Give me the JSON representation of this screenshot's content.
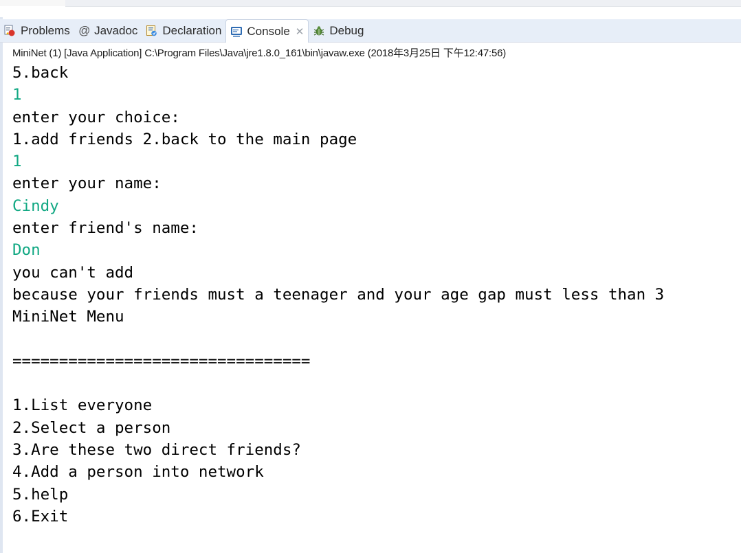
{
  "tabs": [
    {
      "label": "Problems",
      "icon": "problems-icon",
      "active": false
    },
    {
      "label": "Javadoc",
      "icon": "at-icon",
      "active": false
    },
    {
      "label": "Declaration",
      "icon": "declaration-icon",
      "active": false
    },
    {
      "label": "Console",
      "icon": "console-icon",
      "active": true,
      "close": "✕"
    },
    {
      "label": "Debug",
      "icon": "debug-icon",
      "active": false
    }
  ],
  "console_header": "MiniNet (1) [Java Application] C:\\Program Files\\Java\\jre1.8.0_161\\bin\\javaw.exe (2018年3月25日 下午12:47:56)",
  "colors": {
    "input_text": "#11a883",
    "output_text": "#000000"
  },
  "console_lines": [
    {
      "text": "5.back",
      "type": "output"
    },
    {
      "text": "1",
      "type": "input"
    },
    {
      "text": "enter your choice:",
      "type": "output"
    },
    {
      "text": "1.add friends 2.back to the main page",
      "type": "output"
    },
    {
      "text": "1",
      "type": "input"
    },
    {
      "text": "enter your name:",
      "type": "output"
    },
    {
      "text": "Cindy",
      "type": "input"
    },
    {
      "text": "enter friend's name:",
      "type": "output"
    },
    {
      "text": "Don",
      "type": "input"
    },
    {
      "text": "you can't add",
      "type": "output"
    },
    {
      "text": "because your friends must a teenager and your age gap must less than 3",
      "type": "output"
    },
    {
      "text": "MiniNet Menu",
      "type": "output"
    },
    {
      "text": "",
      "type": "output"
    },
    {
      "text": "================================",
      "type": "output"
    },
    {
      "text": "",
      "type": "output"
    },
    {
      "text": "1.List everyone",
      "type": "output"
    },
    {
      "text": "2.Select a person",
      "type": "output"
    },
    {
      "text": "3.Are these two direct friends?",
      "type": "output"
    },
    {
      "text": "4.Add a person into network",
      "type": "output"
    },
    {
      "text": "5.help",
      "type": "output"
    },
    {
      "text": "6.Exit",
      "type": "output"
    }
  ]
}
